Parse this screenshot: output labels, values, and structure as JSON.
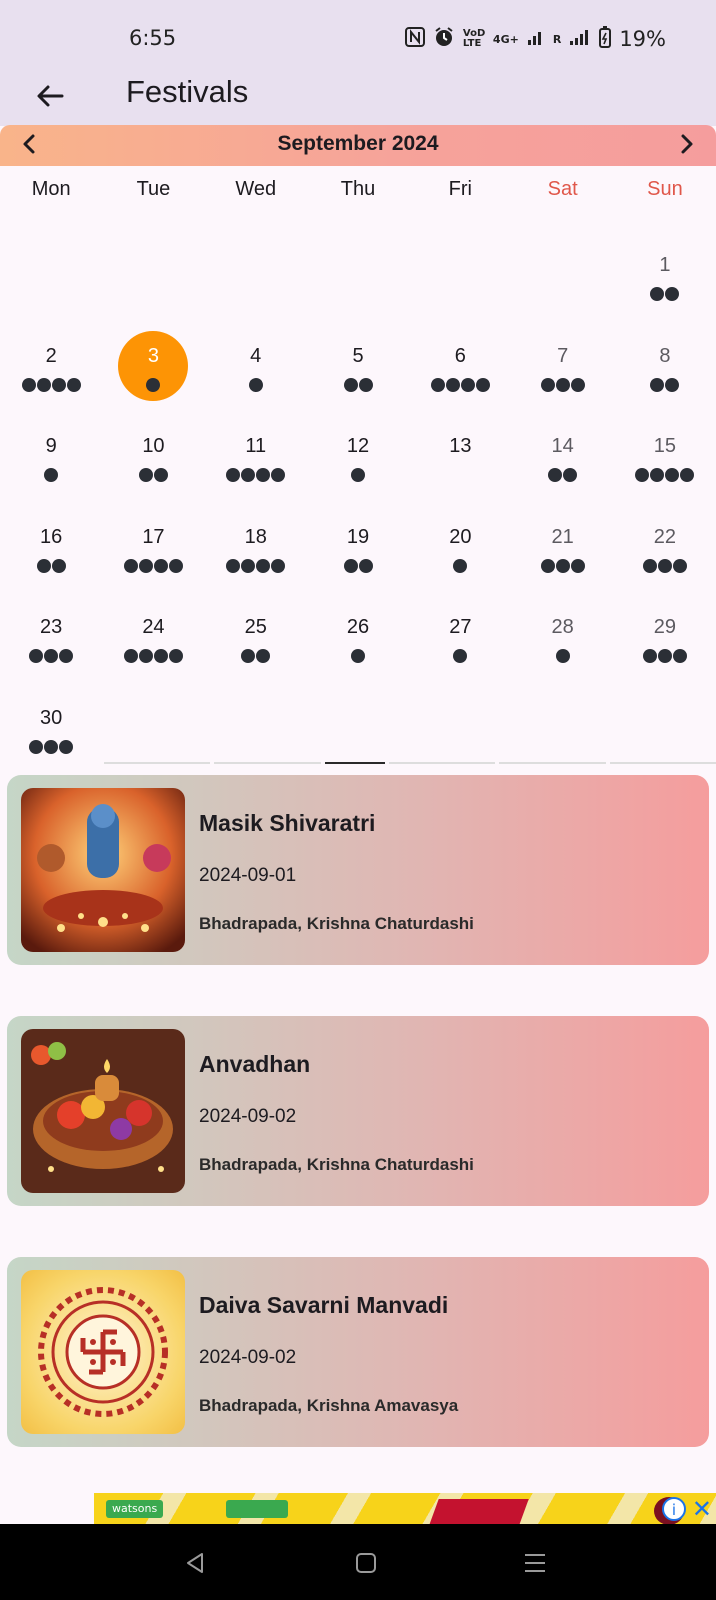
{
  "status": {
    "time": "6:55",
    "battery_percent": "19%",
    "network": "4G+",
    "volte_label": "VoD LTE",
    "signal_label": "R",
    "icons": [
      "nfc-icon",
      "alarm-icon",
      "volte-icon",
      "signal-icon",
      "battery-icon"
    ]
  },
  "appbar": {
    "title": "Festivals",
    "back_icon": "arrow-left-icon"
  },
  "calendar": {
    "month_title": "September 2024",
    "prev_icon": "chevron-left-icon",
    "next_icon": "chevron-right-icon",
    "weekdays": [
      "Mon",
      "Tue",
      "Wed",
      "Thu",
      "Fri",
      "Sat",
      "Sun"
    ],
    "selected_day": "3",
    "selected_color": "#fd9405",
    "weekend_color": "#e0574a",
    "leading_blank_days": 6,
    "days": [
      {
        "day": "1",
        "dots": 2
      },
      {
        "day": "2",
        "dots": 4
      },
      {
        "day": "3",
        "dots": 1
      },
      {
        "day": "4",
        "dots": 1
      },
      {
        "day": "5",
        "dots": 2
      },
      {
        "day": "6",
        "dots": 4
      },
      {
        "day": "7",
        "dots": 3
      },
      {
        "day": "8",
        "dots": 2
      },
      {
        "day": "9",
        "dots": 1
      },
      {
        "day": "10",
        "dots": 2
      },
      {
        "day": "11",
        "dots": 4
      },
      {
        "day": "12",
        "dots": 1
      },
      {
        "day": "13",
        "dots": 0
      },
      {
        "day": "14",
        "dots": 2
      },
      {
        "day": "15",
        "dots": 4
      },
      {
        "day": "16",
        "dots": 2
      },
      {
        "day": "17",
        "dots": 4
      },
      {
        "day": "18",
        "dots": 4
      },
      {
        "day": "19",
        "dots": 2
      },
      {
        "day": "20",
        "dots": 1
      },
      {
        "day": "21",
        "dots": 3
      },
      {
        "day": "22",
        "dots": 3
      },
      {
        "day": "23",
        "dots": 3
      },
      {
        "day": "24",
        "dots": 4
      },
      {
        "day": "25",
        "dots": 2
      },
      {
        "day": "26",
        "dots": 1
      },
      {
        "day": "27",
        "dots": 1
      },
      {
        "day": "28",
        "dots": 1
      },
      {
        "day": "29",
        "dots": 3
      },
      {
        "day": "30",
        "dots": 3
      }
    ]
  },
  "festivals": [
    {
      "name": "Masik Shivaratri",
      "date": "2024-09-01",
      "tithi": "Bhadrapada, Krishna Chaturdashi",
      "image_icon": "shiva-puja-image"
    },
    {
      "name": "Anvadhan",
      "date": "2024-09-02",
      "tithi": "Bhadrapada, Krishna Chaturdashi",
      "image_icon": "fruit-offering-image"
    },
    {
      "name": "Daiva Savarni Manvadi",
      "date": "2024-09-02",
      "tithi": "Bhadrapada, Krishna Amavasya",
      "image_icon": "swastika-mandala-image"
    }
  ],
  "ad": {
    "chip1": "watsons",
    "chip2": "",
    "info_icon": "info-icon",
    "close_icon": "close-icon"
  },
  "navbar": {
    "icons": [
      "back-triangle-icon",
      "home-square-icon",
      "menu-lines-icon"
    ]
  }
}
